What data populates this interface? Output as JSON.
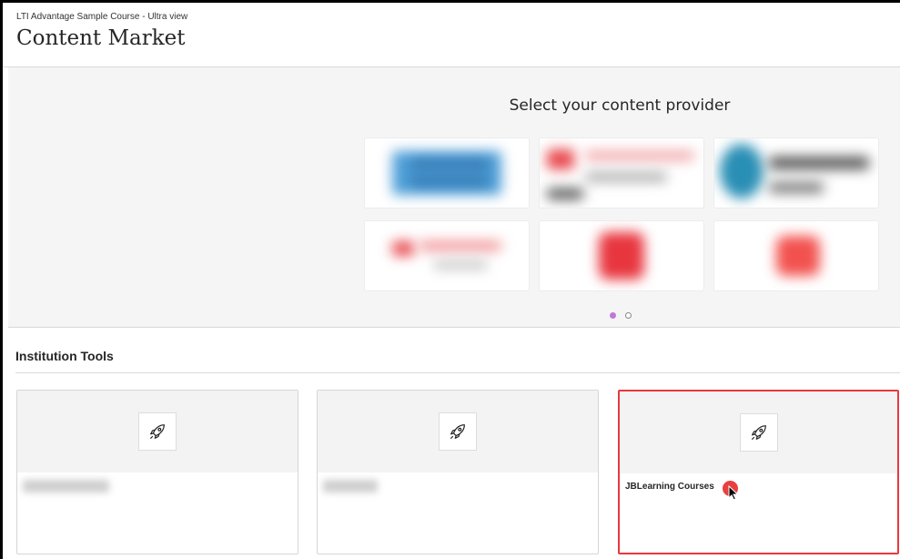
{
  "header": {
    "course_name": "LTI Advantage Sample Course - Ultra view",
    "page_title": "Content Market"
  },
  "providers": {
    "heading": "Select your content provider",
    "carousel_pages": 2,
    "active_page": 1
  },
  "institution_tools": {
    "section_title": "Institution Tools",
    "cards": [
      {
        "label": ""
      },
      {
        "label": ""
      },
      {
        "label": "JBLearning Courses"
      }
    ]
  },
  "icons": {
    "tool_icon": "rocket-icon",
    "pointer": "mouse-pointer-icon"
  },
  "colors": {
    "highlight": "#e8383d",
    "carousel_active": "#c07ad6",
    "cursor_dot": "#ea3f3f"
  }
}
